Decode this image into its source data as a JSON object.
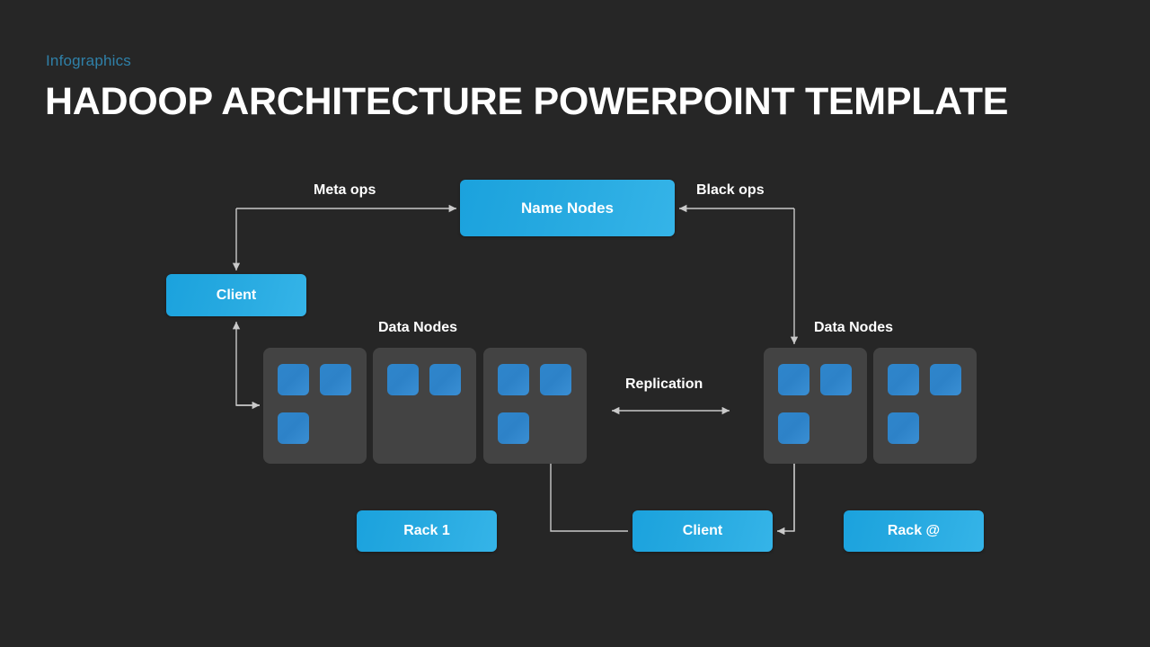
{
  "slide": {
    "background_color": "#262626",
    "kicker": "Infographics",
    "title": "HADOOP ARCHITECTURE POWERPOINT TEMPLATE",
    "kicker_color": "#2f80a8",
    "accent_color": "#26a9e0",
    "node_color": "#2f86cc",
    "rack_color": "#434343",
    "connector_color": "#c9c9c9"
  },
  "boxes": {
    "name_nodes": "Name Nodes",
    "client_top": "Client",
    "rack_1": "Rack 1",
    "client_bottom": "Client",
    "rack_2": "Rack @"
  },
  "captions": {
    "meta_ops": "Meta ops",
    "black_ops": "Black ops",
    "data_nodes_left": "Data Nodes",
    "data_nodes_right": "Data Nodes",
    "replication": "Replication"
  },
  "racks": [
    {
      "id": "rack-a",
      "group": "left",
      "node_count": 3,
      "nodes": [
        "p1",
        "p2",
        "p3"
      ]
    },
    {
      "id": "rack-b",
      "group": "left",
      "node_count": 2,
      "nodes": [
        "p1",
        "p2"
      ]
    },
    {
      "id": "rack-c",
      "group": "left",
      "node_count": 3,
      "nodes": [
        "p1",
        "p2",
        "p3"
      ]
    },
    {
      "id": "rack-d",
      "group": "right",
      "node_count": 3,
      "nodes": [
        "p1",
        "p2",
        "p3"
      ]
    },
    {
      "id": "rack-e",
      "group": "right",
      "node_count": 3,
      "nodes": [
        "p1",
        "p2",
        "p3"
      ]
    }
  ],
  "connectors": [
    {
      "name": "client-to-namenodes",
      "label": "Meta ops",
      "direction": "one-way"
    },
    {
      "name": "namenodes-to-client-branch",
      "label": "Meta ops",
      "direction": "one-way"
    },
    {
      "name": "namenodes-to-datanodes-right",
      "label": "Black ops",
      "direction": "one-way"
    },
    {
      "name": "datanodes-left-to-client-top",
      "label": "",
      "direction": "one-way"
    },
    {
      "name": "replication-left-right",
      "label": "Replication",
      "direction": "two-way"
    },
    {
      "name": "datanodes-left-to-client-bottom",
      "label": "",
      "direction": "one-way"
    },
    {
      "name": "datanodes-right-to-client-bottom",
      "label": "",
      "direction": "one-way"
    }
  ]
}
